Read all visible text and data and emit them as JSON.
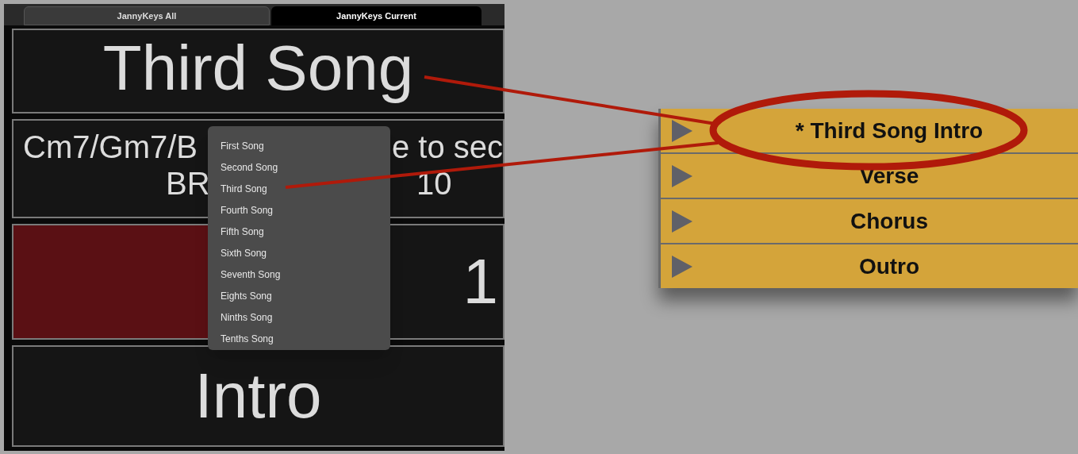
{
  "tabs": [
    {
      "label": "JannyKeys All",
      "selected": false
    },
    {
      "label": "JannyKeys Current",
      "selected": true
    }
  ],
  "song_title": "Third Song",
  "chords": {
    "line_1": [
      "Cm7/Gm7/B",
      "e to sec"
    ],
    "line_2": [
      "BR",
      "10"
    ]
  },
  "counter": "1",
  "section": "Intro",
  "song_menu": [
    "First Song",
    "Second Song",
    "Third Song",
    "Fourth Song",
    "Fifth Song",
    "Sixth Song",
    "Seventh Song",
    "Eights Song",
    "Ninths Song",
    "Tenths Song"
  ],
  "section_list": [
    {
      "label": "* Third Song Intro"
    },
    {
      "label": "Verse"
    },
    {
      "label": "Chorus"
    },
    {
      "label": "Outro"
    }
  ]
}
